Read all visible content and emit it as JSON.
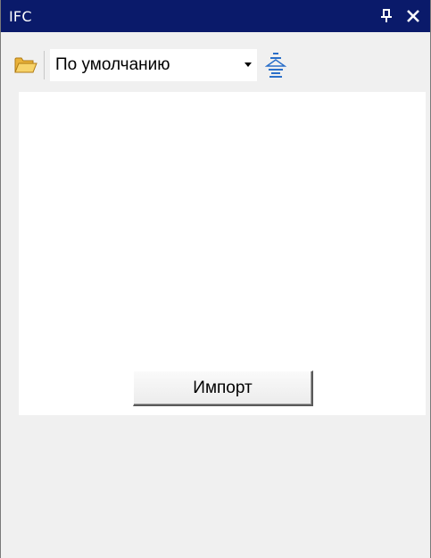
{
  "window": {
    "title": "IFC",
    "pin_icon": "pin-icon",
    "close_icon": "close-icon"
  },
  "toolbar": {
    "open_icon": "folder-open-icon",
    "profile_select": {
      "value": "По умолчанию"
    },
    "tree_icon": "tree-structure-icon"
  },
  "main": {
    "import_label": "Импорт"
  },
  "colors": {
    "titlebar": "#0a1a6a",
    "panel_bg": "#f0f0f0",
    "content_bg": "#ffffff",
    "folder": "#f2c24a",
    "tree_icon": "#2a6fc9"
  }
}
